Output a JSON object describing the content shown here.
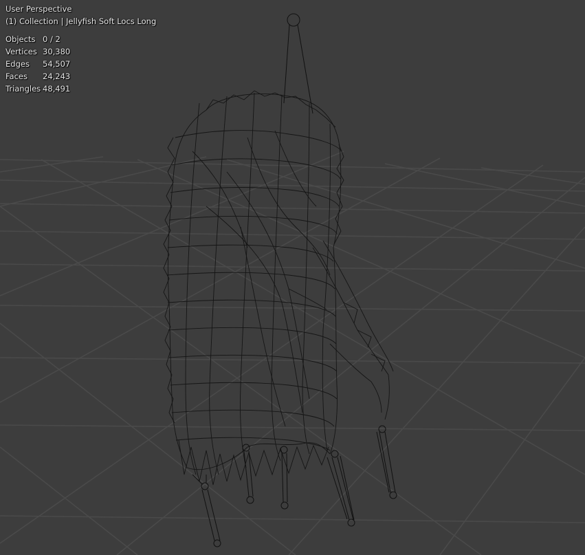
{
  "viewport": {
    "view_name": "User Perspective",
    "collection_line": "(1) Collection | Jellyfish Soft Locs Long"
  },
  "stats": [
    {
      "label": "Objects",
      "value": "0 / 2"
    },
    {
      "label": "Vertices",
      "value": "30,380"
    },
    {
      "label": "Edges",
      "value": "54,507"
    },
    {
      "label": "Faces",
      "value": "24,243"
    },
    {
      "label": "Triangles",
      "value": "48,491"
    }
  ],
  "colors": {
    "background": "#3d3d3d",
    "grid_line": "#4a4a4a",
    "wireframe": "#111111",
    "text": "#e6e6e6"
  }
}
